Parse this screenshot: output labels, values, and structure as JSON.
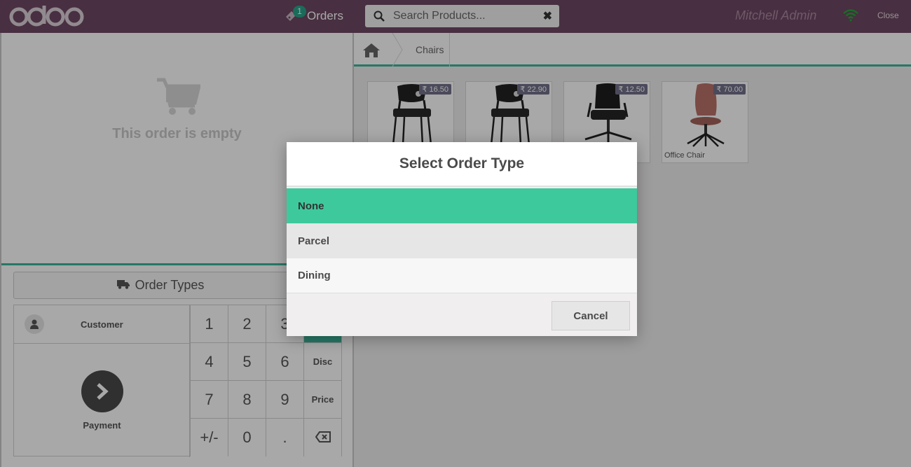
{
  "header": {
    "logo_text": "odoo",
    "orders_label": "Orders",
    "orders_count": "1",
    "search_placeholder": "Search Products...",
    "user_name": "Mitchell Admin",
    "close_label": "Close"
  },
  "order": {
    "empty_text": "This order is empty"
  },
  "controls": {
    "order_types_label": "Order Types",
    "customer_label": "Customer",
    "payment_label": "Payment",
    "keys": {
      "k1": "1",
      "k2": "2",
      "k3": "3",
      "k4": "4",
      "k5": "5",
      "k6": "6",
      "k7": "7",
      "k8": "8",
      "k9": "9",
      "sign": "+/-",
      "k0": "0",
      "dot": ".",
      "disc": "Disc",
      "price": "Price"
    }
  },
  "breadcrumbs": {
    "category": "Chairs"
  },
  "products": [
    {
      "price": "₹ 16.50",
      "name": ""
    },
    {
      "price": "₹ 22.90",
      "name": ""
    },
    {
      "price": "₹ 12.50",
      "name": ""
    },
    {
      "price": "₹ 70.00",
      "name": "Office Chair"
    }
  ],
  "modal": {
    "title": "Select Order Type",
    "options": [
      "None",
      "Parcel",
      "Dining"
    ],
    "selected": "None",
    "cancel_label": "Cancel"
  },
  "colors": {
    "header_bg": "#6e4863",
    "accent": "#3bb79a",
    "selected_option": "#3ec99c",
    "price_tag": "#73718b"
  }
}
